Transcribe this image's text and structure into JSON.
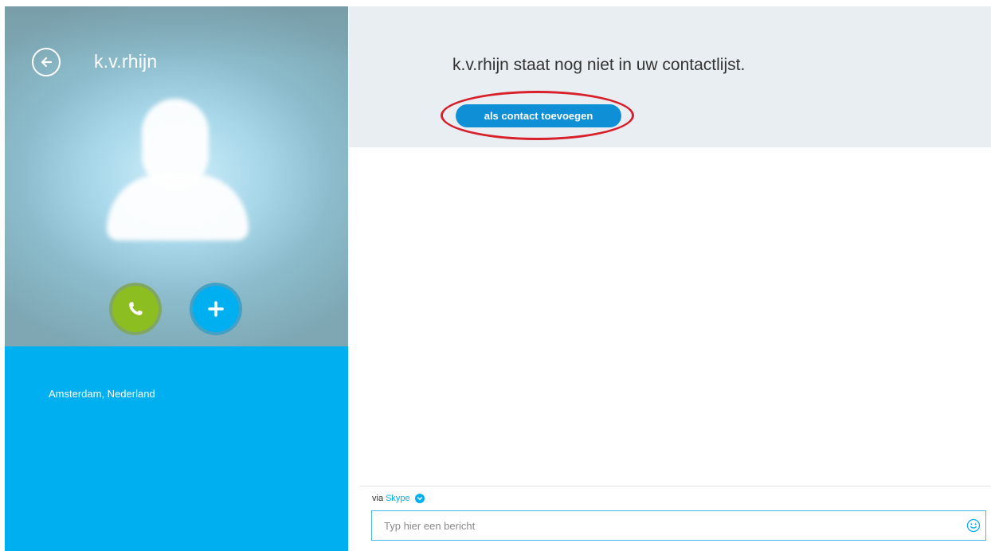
{
  "contact": {
    "name": "k.v.rhijn",
    "location": "Amsterdam, Nederland"
  },
  "notice": {
    "text": "k.v.rhijn staat nog niet in uw contactlijst.",
    "add_contact_label": "als contact toevoegen"
  },
  "composer": {
    "via_label": "via",
    "via_service": "Skype",
    "placeholder": "Typ hier een bericht"
  },
  "icons": {
    "back": "back-arrow-icon",
    "call": "phone-icon",
    "add": "plus-icon",
    "dropdown": "chevron-down-icon",
    "emoticon": "smiley-icon"
  },
  "colors": {
    "accent": "#00aff0",
    "call_green": "#8cbd21",
    "button_blue": "#0f8fd6",
    "highlight_red": "#d8202b",
    "notice_bg": "#e8eef2"
  }
}
